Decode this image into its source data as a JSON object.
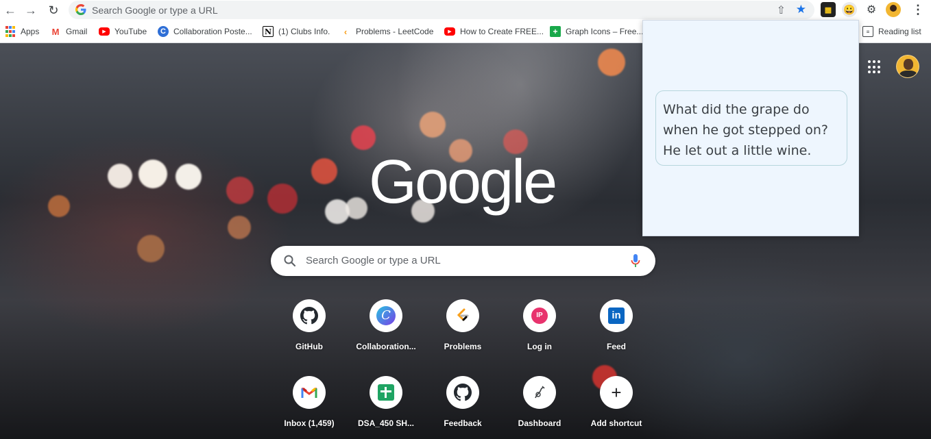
{
  "browser": {
    "omnibox_placeholder": "Search Google or type a URL",
    "bookmarks": [
      {
        "label": "Apps",
        "icon": "apps-grid-icon"
      },
      {
        "label": "Gmail",
        "icon": "gmail-icon"
      },
      {
        "label": "YouTube",
        "icon": "youtube-icon"
      },
      {
        "label": "Collaboration Poste...",
        "icon": "canva-icon"
      },
      {
        "label": "(1) Clubs Info.",
        "icon": "notion-icon"
      },
      {
        "label": "Problems - LeetCode",
        "icon": "leetcode-icon"
      },
      {
        "label": "How to Create FREE...",
        "icon": "youtube-icon"
      },
      {
        "label": "Graph Icons – Free...",
        "icon": "green-icon"
      }
    ],
    "reading_list_label": "Reading list",
    "accent_color": "#1a73e8"
  },
  "ntp": {
    "logo_text": "Google",
    "search_placeholder": "Search Google or type a URL",
    "shortcuts": [
      {
        "title": "GitHub",
        "icon": "github-icon"
      },
      {
        "title": "Collaboration...",
        "icon": "canva-icon"
      },
      {
        "title": "Problems",
        "icon": "leetcode-icon"
      },
      {
        "title": "Log in",
        "icon": "ip-icon"
      },
      {
        "title": "Feed",
        "icon": "linkedin-icon"
      },
      {
        "title": "Inbox (1,459)",
        "icon": "gmail-icon"
      },
      {
        "title": "DSA_450 SH...",
        "icon": "sheets-icon"
      },
      {
        "title": "Feedback",
        "icon": "github-icon"
      },
      {
        "title": "Dashboard",
        "icon": "dashboard-icon"
      },
      {
        "title": "Add shortcut",
        "icon": "plus-icon"
      }
    ]
  },
  "popup": {
    "joke_lines": [
      "What did the grape do",
      "when he got stepped on?",
      "He let out a little wine."
    ]
  }
}
